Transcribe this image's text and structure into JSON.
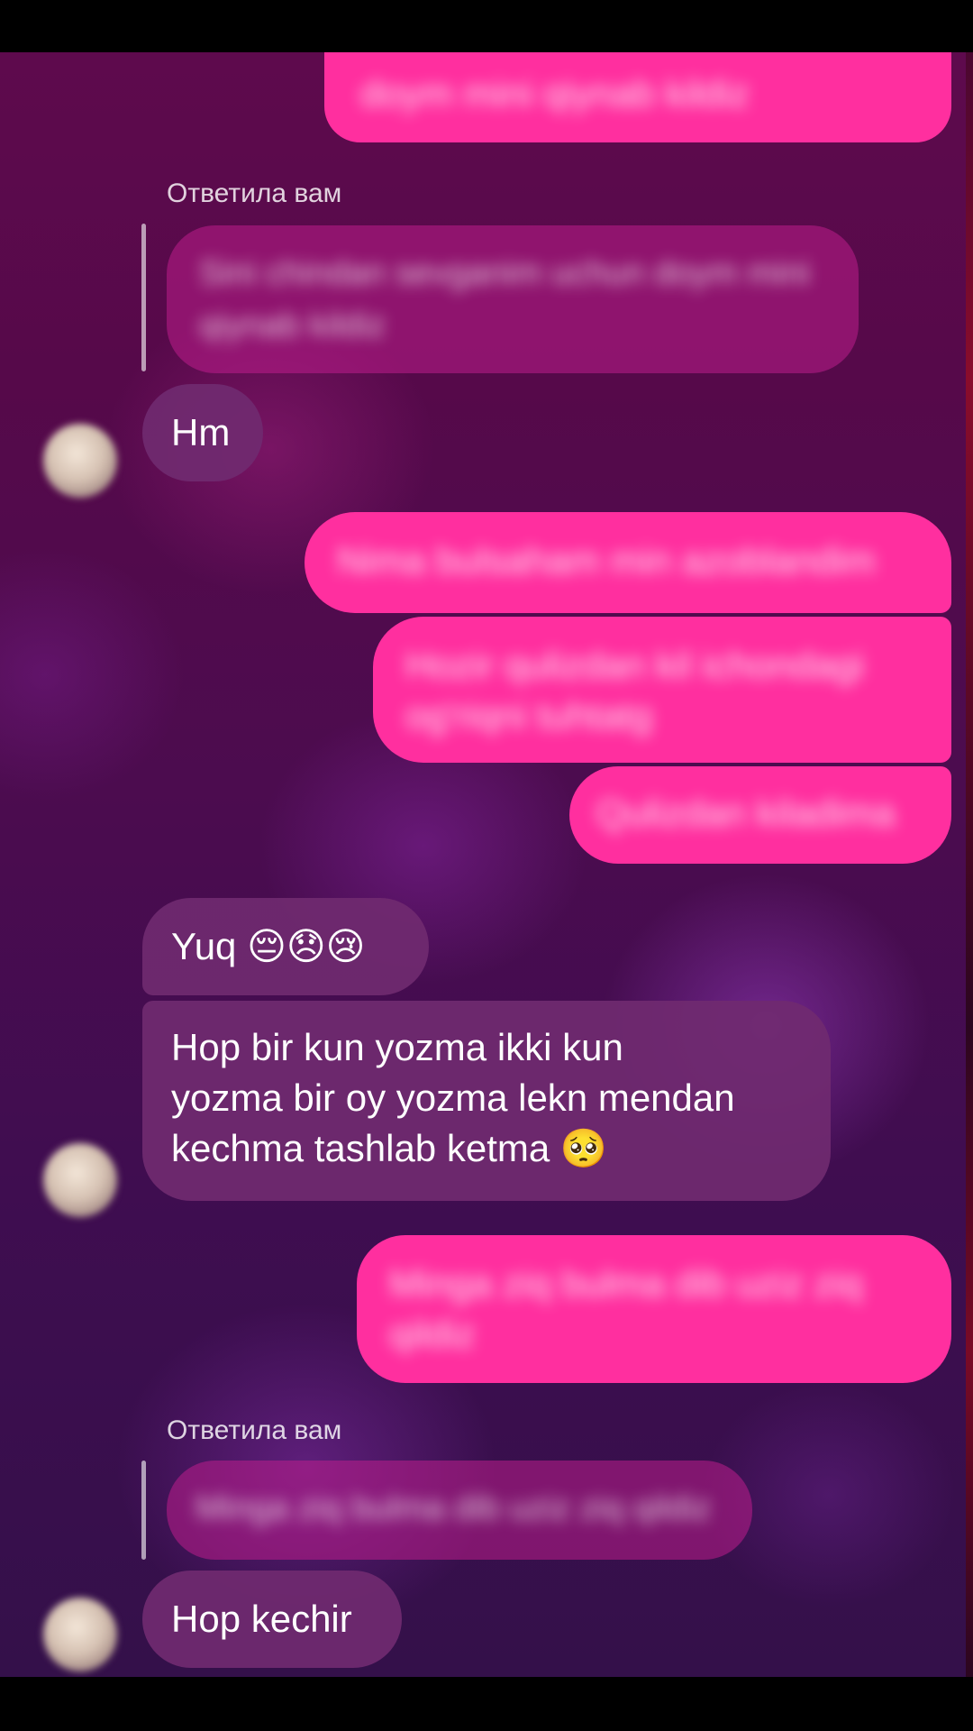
{
  "reply_label_1": "Ответила вам",
  "reply_label_2": "Ответила вам",
  "messages": {
    "sent_top": "doym mini qiynab kildiz",
    "quoted_1": "Sini chindan sevganim uchun doym mini qiynab kildiz",
    "recv_hm": "Hm",
    "sent_2": "Nima bulsaham min azoblandim",
    "sent_3": "Hozir qulizdan kil ichondagi og'riqni tuhtatg",
    "sent_4": "Qulizdan kiladima",
    "recv_yuq": "Yuq 😔😞😢",
    "recv_hop_long": "Hop bir kun yozma ikki kun\nyozma bir oy yozma lekn mendan\nkechma tashlab ketma 🥺",
    "sent_5": "Minga ziq bulma dib uziz ziq qildiz",
    "quoted_2": "Minga ziq bulma dib uziz ziq qildiz",
    "recv_hop_kechir": "Hop kechir"
  },
  "colors": {
    "sent_bubble": "#ff2f9f",
    "received_bubble": "#702a70",
    "background_top": "#5e0a4d",
    "background_bottom": "#34104a"
  },
  "icons": {
    "avatar": "contact-avatar-blurred"
  }
}
